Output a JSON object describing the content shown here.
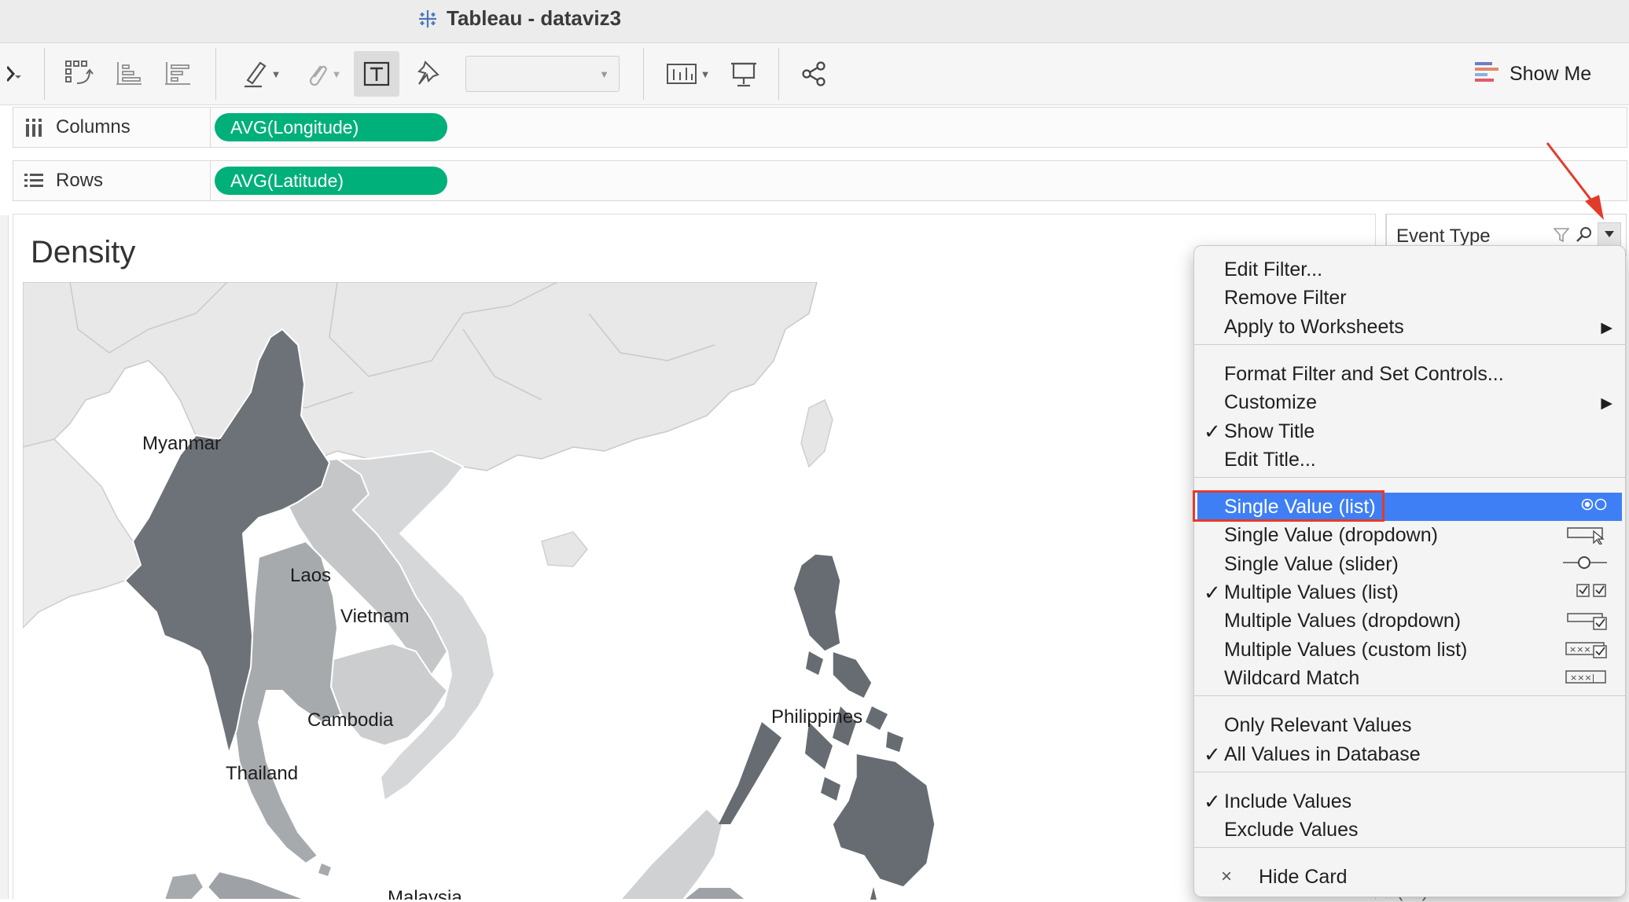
{
  "window": {
    "title": "Tableau - dataviz3"
  },
  "toolbar": {
    "show_me_label": "Show Me",
    "dropdown_value": "",
    "colors": {
      "text_tool_active_bg": "#dcdcdc"
    }
  },
  "shelves": {
    "columns": {
      "label": "Columns",
      "pill": "AVG(Longitude)"
    },
    "rows": {
      "label": "Rows",
      "pill": "AVG(Latitude)"
    },
    "pill_color": "#00b07a"
  },
  "worksheet": {
    "title": "Density",
    "countries": [
      {
        "name": "Myanmar",
        "shade": "#6d7278"
      },
      {
        "name": "Laos",
        "shade": "#c4c6c8"
      },
      {
        "name": "Vietnam",
        "shade": "#d5d7d9"
      },
      {
        "name": "Cambodia",
        "shade": "#cbcdcf"
      },
      {
        "name": "Thailand",
        "shade": "#a7aaad"
      },
      {
        "name": "Philippines",
        "shade": "#676c73"
      },
      {
        "name": "Malaysia",
        "shade": "#9ea1a5"
      }
    ]
  },
  "filter_card": {
    "title": "Event Type",
    "bottom_text": "(All)"
  },
  "context_menu": {
    "highlight_color": "#3f7ff5",
    "annotation_color": "#e33b2a",
    "groups": [
      [
        {
          "label": "Edit Filter...",
          "checked": false
        },
        {
          "label": "Remove Filter",
          "checked": false
        },
        {
          "label": "Apply to Worksheets",
          "checked": false,
          "submenu": true
        }
      ],
      [
        {
          "label": "Format Filter and Set Controls...",
          "checked": false
        },
        {
          "label": "Customize",
          "checked": false,
          "submenu": true
        },
        {
          "label": "Show Title",
          "checked": true
        },
        {
          "label": "Edit Title...",
          "checked": false
        }
      ],
      [
        {
          "label": "Single Value (list)",
          "checked": false,
          "selected": true,
          "icon": "radio-list-icon"
        },
        {
          "label": "Single Value (dropdown)",
          "checked": false,
          "icon": "dropdown-cursor-icon"
        },
        {
          "label": "Single Value (slider)",
          "checked": false,
          "icon": "slider-icon"
        },
        {
          "label": "Multiple Values (list)",
          "checked": true,
          "icon": "checkbox-list-icon"
        },
        {
          "label": "Multiple Values (dropdown)",
          "checked": false,
          "icon": "dropdown-checkbox-icon"
        },
        {
          "label": "Multiple Values (custom list)",
          "checked": false,
          "icon": "custom-list-icon"
        },
        {
          "label": "Wildcard Match",
          "checked": false,
          "icon": "wildcard-icon"
        }
      ],
      [
        {
          "label": "Only Relevant Values",
          "checked": false
        },
        {
          "label": "All Values in Database",
          "checked": true
        }
      ],
      [
        {
          "label": "Include Values",
          "checked": true
        },
        {
          "label": "Exclude Values",
          "checked": false
        }
      ],
      [
        {
          "label": "Hide Card",
          "checked": false,
          "close_icon": true
        }
      ]
    ]
  }
}
